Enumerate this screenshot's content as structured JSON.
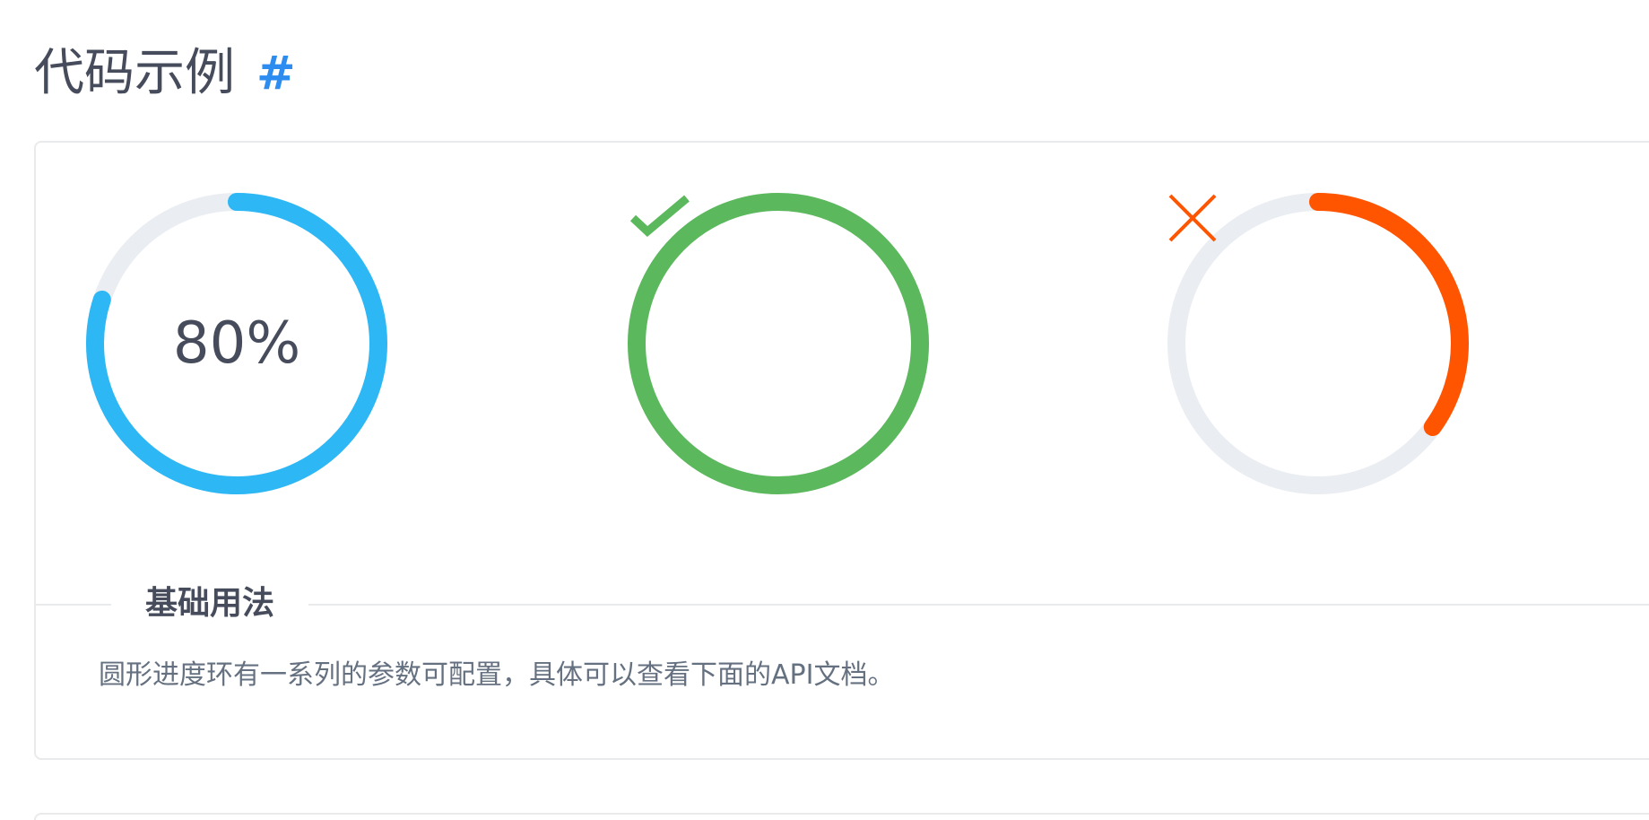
{
  "section": {
    "title": "代码示例",
    "anchor": "#"
  },
  "demos": [
    {
      "kind": "percent",
      "percent": 80,
      "label": "80%",
      "color": "#2db7f5",
      "trail_color": "#eaedf1",
      "icon": ""
    },
    {
      "kind": "success",
      "percent": 100,
      "label": "",
      "color": "#5cb85c",
      "trail_color": "#eaedf1",
      "icon": "check-icon"
    },
    {
      "kind": "error",
      "percent": 35,
      "label": "",
      "color": "#ff5500",
      "trail_color": "#eaedf1",
      "icon": "close-icon"
    }
  ],
  "description": {
    "title": "基础用法",
    "text": "圆形进度环有一系列的参数可配置，具体可以查看下面的API文档。"
  }
}
